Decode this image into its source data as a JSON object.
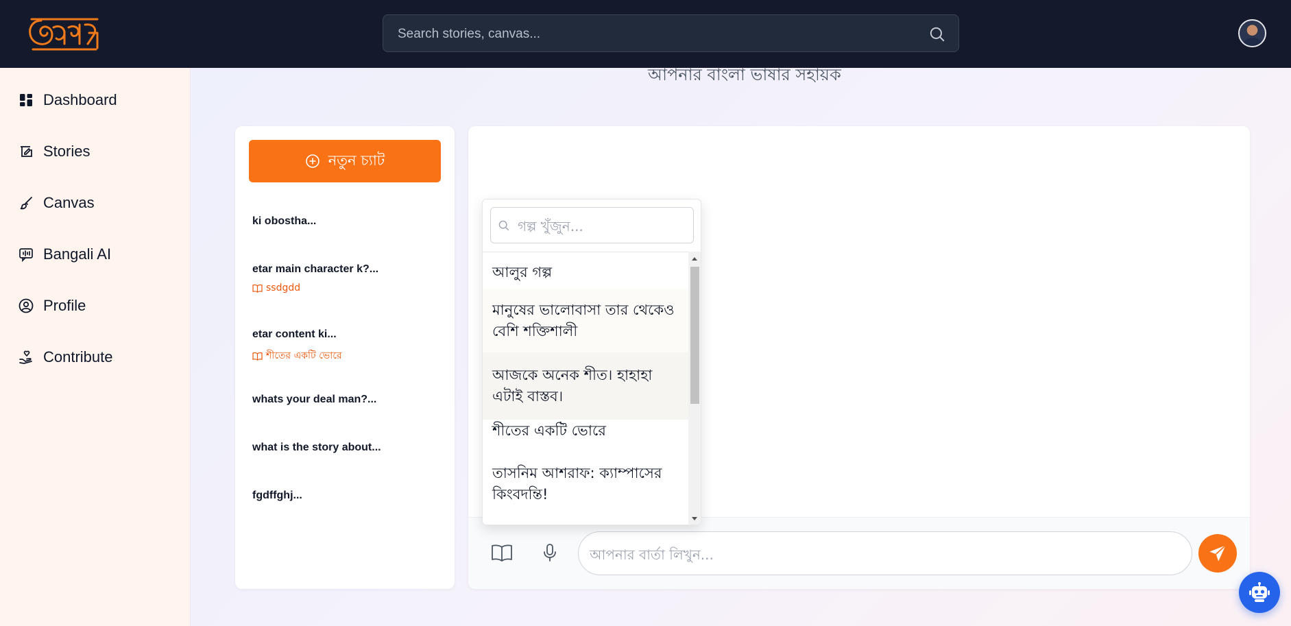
{
  "header": {
    "logo_text": "অক্ষর",
    "search_placeholder": "Search stories, canvas...",
    "search_icon": "search-icon",
    "avatar_icon": "user-avatar"
  },
  "sidebar": {
    "items": [
      {
        "label": "Dashboard",
        "icon": "dashboard-icon"
      },
      {
        "label": "Stories",
        "icon": "stories-icon"
      },
      {
        "label": "Canvas",
        "icon": "brush-icon"
      },
      {
        "label": "Bangali AI",
        "icon": "ai-icon"
      },
      {
        "label": "Profile",
        "icon": "user-circle-icon"
      },
      {
        "label": "Contribute",
        "icon": "contribute-icon"
      }
    ]
  },
  "main": {
    "subtitle": "আপনার বাংলা ভাষার সহায়ক"
  },
  "chat_list": {
    "new_chat_label": "নতুন চ্যাট",
    "items": [
      {
        "title": "ki obostha...",
        "story": ""
      },
      {
        "title": "etar main character k?...",
        "story": "ssdgdd"
      },
      {
        "title": "etar content ki...",
        "story": "শীতের একটি ভোরে"
      },
      {
        "title": "whats your deal man?...",
        "story": ""
      },
      {
        "title": "what is the story about...",
        "story": ""
      },
      {
        "title": "fgdffghj...",
        "story": ""
      }
    ]
  },
  "story_picker": {
    "search_placeholder": "গল্প খুঁজুন...",
    "items": [
      "আলুর গল্প",
      "মানুষের ভালোবাসা তার থেকেও বেশি শক্তিশালী",
      "আজকে অনেক শীত। হাহাহা এটাই বাস্তব।",
      "শীতের একটি ভোরে",
      "তাসনিম আশরাফ: ক্যাম্পাসের কিংবদন্তি!"
    ]
  },
  "composer": {
    "placeholder": "আপনার বার্তা লিখুন..."
  },
  "colors": {
    "accent": "#f97316",
    "topbar": "#141a2c",
    "sidebar_bg": "#fff5ee",
    "bot_button": "#2563eb"
  }
}
